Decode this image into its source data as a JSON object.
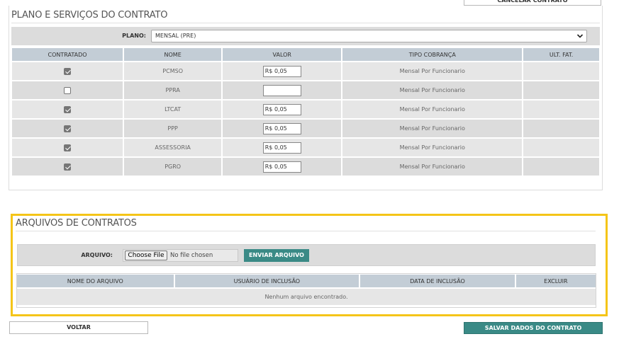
{
  "top_actions": {
    "cancel_label": "CANCELAR CONTRATO"
  },
  "plans_section": {
    "title": "PLANO E SERVIÇOS DO CONTRATO",
    "plano_label": "PLANO:",
    "plano_selected": "MENSAL (PRE)",
    "columns": [
      "CONTRATADO",
      "NOME",
      "VALOR",
      "TIPO COBRANÇA",
      "ULT. FAT."
    ],
    "rows": [
      {
        "contratado": true,
        "nome": "PCMSO",
        "valor": "R$ 0,05",
        "tipo": "Mensal Por Funcionario",
        "ult_fat": ""
      },
      {
        "contratado": false,
        "nome": "PPRA",
        "valor": "",
        "tipo": "Mensal Por Funcionario",
        "ult_fat": ""
      },
      {
        "contratado": true,
        "nome": "LTCAT",
        "valor": "R$ 0,05",
        "tipo": "Mensal Por Funcionario",
        "ult_fat": ""
      },
      {
        "contratado": true,
        "nome": "PPP",
        "valor": "R$ 0,05",
        "tipo": "Mensal Por Funcionario",
        "ult_fat": ""
      },
      {
        "contratado": true,
        "nome": "ASSESSORIA",
        "valor": "R$ 0,05",
        "tipo": "Mensal Por Funcionario",
        "ult_fat": ""
      },
      {
        "contratado": true,
        "nome": "PGRO",
        "valor": "R$ 0,05",
        "tipo": "Mensal Por Funcionario",
        "ult_fat": ""
      }
    ]
  },
  "files_section": {
    "title": "ARQUIVOS DE CONTRATOS",
    "arquivo_label": "ARQUIVO:",
    "choose_file_label": "Choose File",
    "no_file_text": "No file chosen",
    "upload_label": "ENVIAR ARQUIVO",
    "columns": [
      "NOME DO ARQUIVO",
      "USUÁRIO DE INCLUSÃO",
      "DATA DE INCLUSÃO",
      "EXCLUIR"
    ],
    "empty_text": "Nenhum arquivo encontrado."
  },
  "footer": {
    "back_label": "VOLTAR",
    "save_label": "SALVAR DADOS DO CONTRATO"
  },
  "colors": {
    "accent": "#3a8a86",
    "highlight_border": "#f5c518",
    "header_bg": "#c3cdd6"
  }
}
